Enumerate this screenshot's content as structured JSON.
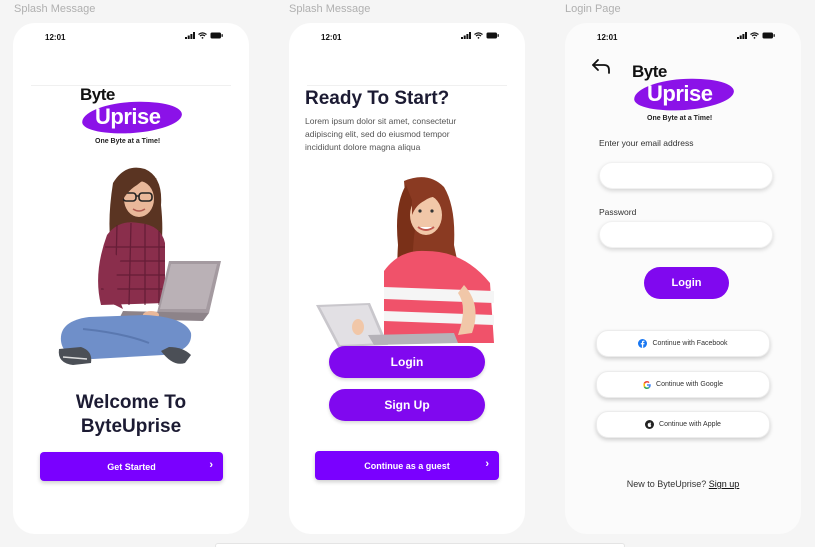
{
  "frames": [
    {
      "label": "Splash Message"
    },
    {
      "label": "Splash Message"
    },
    {
      "label": "Login Page"
    }
  ],
  "status": {
    "time": "12:01"
  },
  "logo": {
    "word1": "Byte",
    "word2": "Uprise",
    "tagline": "One Byte at a Time!",
    "pill_color": "#8b12e8"
  },
  "splash1": {
    "title_line1": "Welcome To",
    "title_line2": "ByteUprise",
    "cta_label": "Get Started",
    "cta_icon": "chevron-right-icon"
  },
  "splash2": {
    "title": "Ready To Start?",
    "body": "Lorem ipsum dolor sit amet, consectetur adipiscing elit, sed do eiusmod tempor incididunt dolore magna aliqua",
    "login_label": "Login",
    "signup_label": "Sign Up",
    "guest_label": "Continue as a guest",
    "guest_icon": "chevron-right-icon"
  },
  "login": {
    "back_icon": "back-arrow-icon",
    "email_label": "Enter your email address",
    "email_value": "",
    "password_label": "Password",
    "password_value": "",
    "login_label": "Login",
    "facebook_label": "Continue with Facebook",
    "google_label": "Continue with Google",
    "apple_label": "Continue with Apple",
    "signup_prompt": "New to ByteUprise?",
    "signup_link": "Sign up"
  },
  "colors": {
    "accent": "#7a00ff",
    "accent_pill": "#8008ef",
    "title": "#1c1b33"
  }
}
